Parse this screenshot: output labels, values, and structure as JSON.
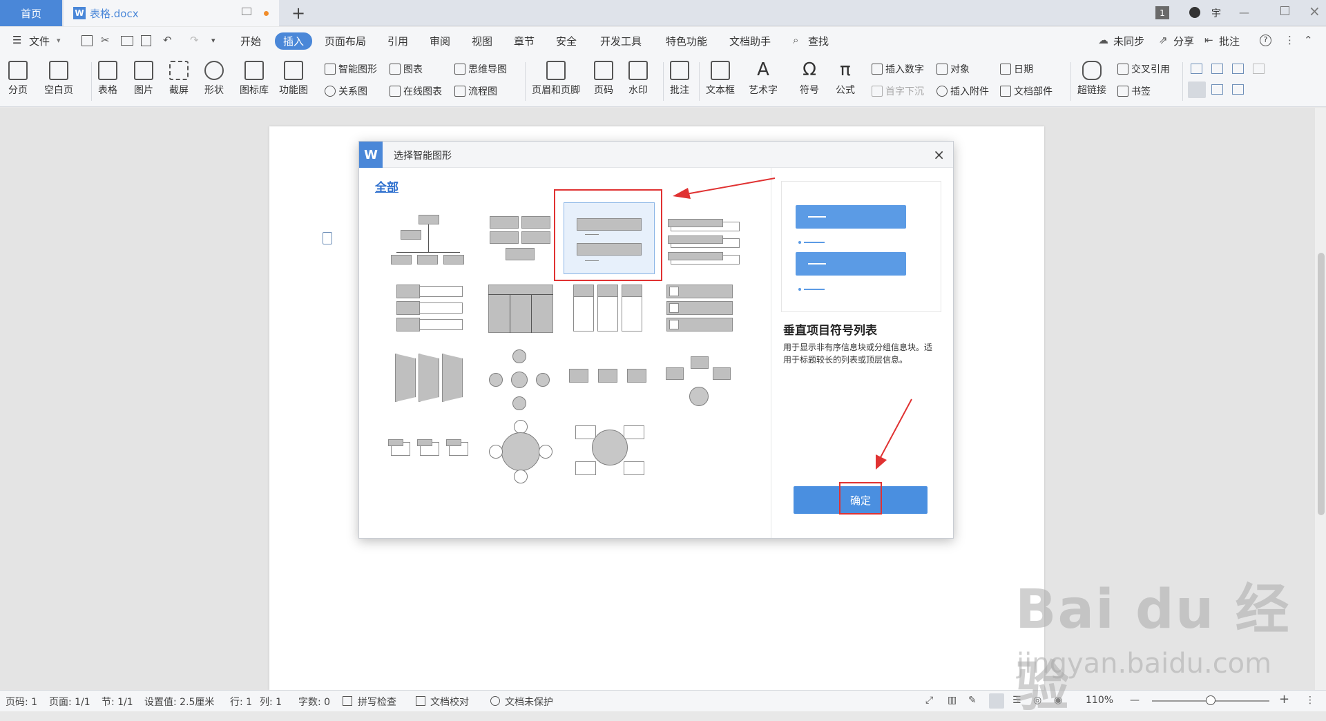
{
  "tabs": {
    "home": "首页",
    "doc": "表格.docx",
    "add": "+"
  },
  "top_right": {
    "page_badge": "1",
    "user": "宇"
  },
  "menu": {
    "file": "文件",
    "items": [
      "开始",
      "插入",
      "页面布局",
      "引用",
      "审阅",
      "视图",
      "章节",
      "安全",
      "开发工具",
      "特色功能",
      "文档助手",
      "查找"
    ],
    "right": [
      "未同步",
      "分享",
      "批注"
    ]
  },
  "ribbon": {
    "big": [
      "分页",
      "空白页",
      "表格",
      "图片",
      "截屏",
      "形状",
      "图标库",
      "功能图",
      "页眉和页脚",
      "页码",
      "水印",
      "批注",
      "文本框",
      "艺术字",
      "符号",
      "公式",
      "超链接"
    ],
    "small": [
      "智能图形",
      "关系图",
      "图表",
      "在线图表",
      "思维导图",
      "流程图",
      "插入数字",
      "首字下沉",
      "对象",
      "插入附件",
      "日期",
      "文档部件",
      "交叉引用",
      "书签"
    ]
  },
  "dialog": {
    "title": "选择智能图形",
    "category": "全部",
    "preview_name": "垂直项目符号列表",
    "preview_desc": "用于显示非有序信息块或分组信息块。适用于标题较长的列表或顶层信息。",
    "ok": "确定",
    "colors": {
      "accent": "#4a87d8",
      "highlight": "#e03232",
      "preview_bar": "#5b9be5"
    }
  },
  "status": {
    "page": "页码: 1",
    "pages": "页面: 1/1",
    "section": "节: 1/1",
    "setting": "设置值: 2.5厘米",
    "row": "行: 1",
    "col": "列: 1",
    "words": "字数: 0",
    "spell": "拼写检查",
    "proof": "文档校对",
    "protect": "文档未保护",
    "zoom": "110%"
  },
  "watermark": {
    "brand": "Bai du 经验",
    "url": "jingyan.baidu.com"
  }
}
